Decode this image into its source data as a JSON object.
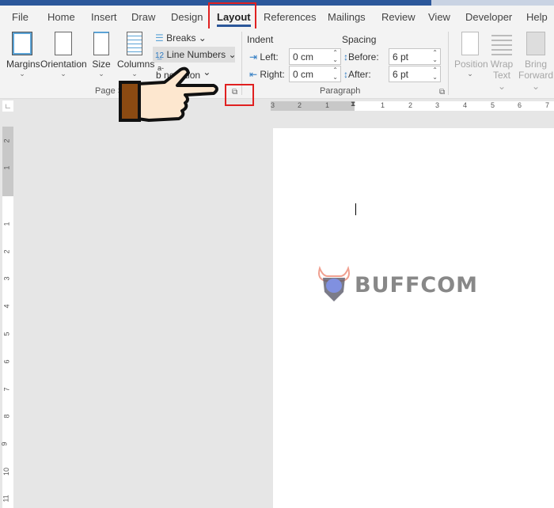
{
  "tabs": [
    "File",
    "Home",
    "Insert",
    "Draw",
    "Design",
    "Layout",
    "References",
    "Mailings",
    "Review",
    "View",
    "Developer",
    "Help"
  ],
  "active_tab": "Layout",
  "page_setup": {
    "margins": "Margins",
    "orientation": "Orientation",
    "size": "Size",
    "columns": "Columns",
    "breaks": "Breaks",
    "line_numbers": "Line Numbers",
    "hyphenation_prefix": "a-",
    "hyphenation": "b  nenation",
    "group_label": "Page S"
  },
  "paragraph": {
    "indent_label": "Indent",
    "spacing_label": "Spacing",
    "left_label": "Left:",
    "left_value": "0 cm",
    "right_label": "Right:",
    "right_value": "0 cm",
    "before_label": "Before:",
    "before_value": "6 pt",
    "after_label": "After:",
    "after_value": "6 pt",
    "group_label": "Paragraph"
  },
  "arrange": {
    "position": "Position",
    "wrap": "Wrap",
    "wrap2": "Text",
    "bring": "Bring",
    "bring2": "Forward"
  },
  "hruler": [
    "3",
    "2",
    "1",
    "1",
    "2",
    "3",
    "4",
    "5",
    "6",
    "7"
  ],
  "vruler": [
    "2",
    "1",
    "1",
    "2",
    "3",
    "4",
    "5",
    "6",
    "7",
    "8",
    "9",
    "10",
    "11"
  ],
  "watermark": "BUFFCOM",
  "colors": {
    "accent": "#2b579a",
    "highlight": "#e02020"
  }
}
